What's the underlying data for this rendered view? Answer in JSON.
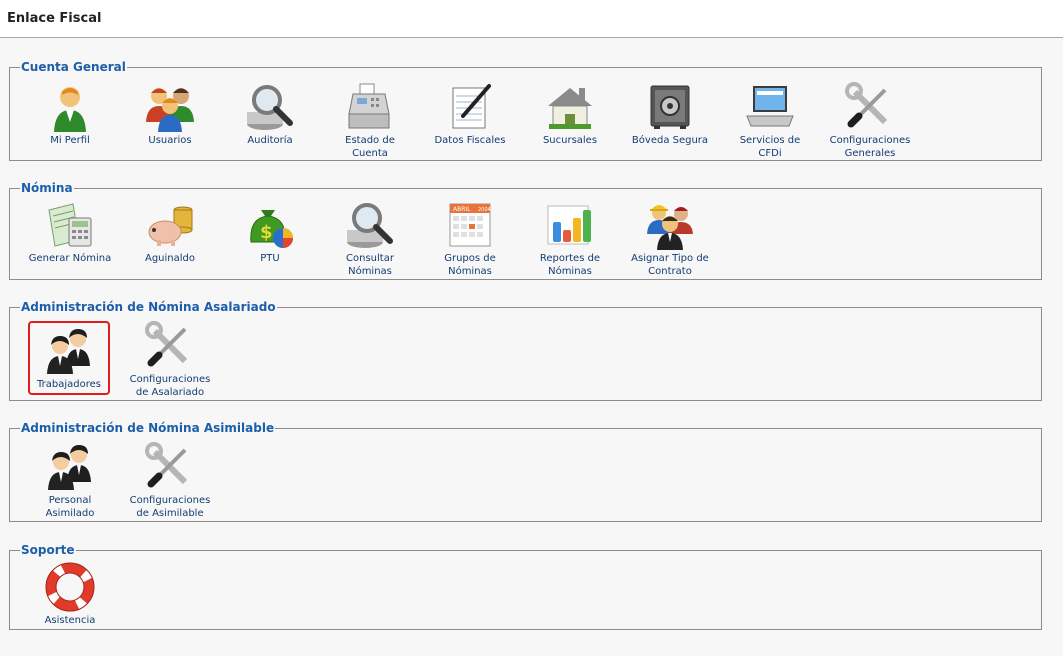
{
  "header": {
    "title": "Enlace Fiscal"
  },
  "sections": [
    {
      "legend": "Cuenta General",
      "items": [
        {
          "label": "Mi Perfil",
          "icon": "user-icon"
        },
        {
          "label": "Usuarios",
          "icon": "users-icon"
        },
        {
          "label": "Auditoría",
          "icon": "magnifier-icon"
        },
        {
          "label": "Estado de\nCuenta",
          "icon": "cash-register-icon"
        },
        {
          "label": "Datos Fiscales",
          "icon": "notepad-pen-icon"
        },
        {
          "label": "Sucursales",
          "icon": "house-icon"
        },
        {
          "label": "Bóveda Segura",
          "icon": "safe-icon"
        },
        {
          "label": "Servicios de\nCFDi",
          "icon": "laptop-icon"
        },
        {
          "label": "Configuraciones\nGenerales",
          "icon": "tools-icon"
        }
      ]
    },
    {
      "legend": "Nómina",
      "items": [
        {
          "label": "Generar Nómina",
          "icon": "calculator-icon"
        },
        {
          "label": "Aguinaldo",
          "icon": "piggy-bank-icon"
        },
        {
          "label": "PTU",
          "icon": "money-bag-icon"
        },
        {
          "label": "Consultar\nNóminas",
          "icon": "magnifier-icon"
        },
        {
          "label": "Grupos de\nNóminas",
          "icon": "calendar-icon",
          "calendar_text": "ABRIL",
          "calendar_year": "2004"
        },
        {
          "label": "Reportes de\nNóminas",
          "icon": "bar-chart-icon"
        },
        {
          "label": "Asignar Tipo de\nContrato",
          "icon": "workers-icon"
        }
      ]
    },
    {
      "legend": "Administración de Nómina Asalariado",
      "items": [
        {
          "label": "Trabajadores",
          "icon": "people-icon",
          "selected": true
        },
        {
          "label": "Configuraciones\nde Asalariado",
          "icon": "tools-icon"
        }
      ]
    },
    {
      "legend": "Administración de Nómina Asimilable",
      "items": [
        {
          "label": "Personal\nAsimilado",
          "icon": "people-icon"
        },
        {
          "label": "Configuraciones\nde Asimilable",
          "icon": "tools-icon"
        }
      ]
    },
    {
      "legend": "Soporte",
      "items": [
        {
          "label": "Asistencia",
          "icon": "lifebuoy-icon"
        }
      ]
    }
  ],
  "colors": {
    "legend": "#1d5ea8",
    "label": "#123c73",
    "selected_border": "#e21b1b"
  }
}
